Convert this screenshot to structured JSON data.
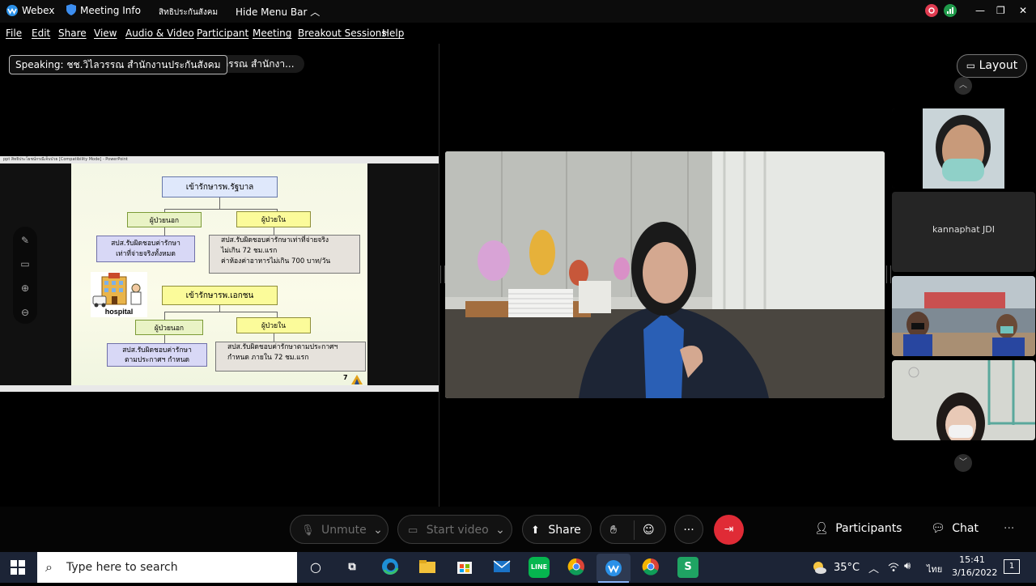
{
  "titlebar": {
    "app_name": "Webex",
    "meeting_info": "Meeting Info",
    "meeting_name": "สิทธิประกันสังคม",
    "hide_menu": "Hide Menu Bar",
    "minimize": "—",
    "restore": "❐",
    "close": "✕"
  },
  "menubar": {
    "items": [
      "File",
      "Edit",
      "Share",
      "View",
      "Audio & Video",
      "Participant",
      "Meeting",
      "Breakout Sessions",
      "Help"
    ]
  },
  "speaking": {
    "label": "Speaking: ชช.วิไลวรรณ สำนักงานประกันสังคม",
    "ghost": "ไลวรรณ สำนักงา..."
  },
  "slide": {
    "window_title": "ppt สิทธิประโยชน์กรณีเจ็บป่วย [Compatibility Mode] - PowerPoint",
    "gov_hospital": "เข้ารักษารพ.รัฐบาล",
    "opd1": "ผู้ป่วยนอก",
    "ipd1": "ผู้ป่วยใน",
    "opd1_desc": [
      "สปส.รับผิดชอบค่ารักษา",
      "เท่าที่จ่ายจริงทั้งหมด"
    ],
    "ipd1_desc": [
      "สปส.รับผิดชอบค่ารักษาเท่าที่จ่ายจริง",
      "ไม่เกิน 72 ชม.แรก",
      "ค่าห้องค่าอาหารไม่เกิน 700 บาท/วัน"
    ],
    "hospital_label": "hospital",
    "private_hospital": "เข้ารักษารพ.เอกชน",
    "opd2": "ผู้ป่วยนอก",
    "ipd2": "ผู้ป่วยใน",
    "opd2_desc": [
      "สปส.รับผิดชอบค่ารักษา",
      "ตามประกาศฯ กำหนด"
    ],
    "ipd2_desc": [
      "สปส.รับผิดชอบค่ารักษาตามประกาศฯ",
      "กำหนด ภายใน 72 ชม.แรก"
    ],
    "page_number": "7"
  },
  "layout_button": {
    "label": "Layout",
    "icon": "layout-icon"
  },
  "participants_thumbs": [
    {
      "name": ""
    },
    {
      "name": "kannaphat JDI"
    },
    {
      "name": ""
    },
    {
      "name": ""
    }
  ],
  "controls": {
    "unmute": "Unmute",
    "start_video": "Start video",
    "share": "Share",
    "participants": "Participants",
    "chat": "Chat",
    "more": "···",
    "ellipsis": "···"
  },
  "taskbar": {
    "search_placeholder": "Type here to search",
    "weather": "35°C",
    "language": "ไทย",
    "time": "15:41",
    "date": "3/16/2022",
    "notifications": "1"
  },
  "colors": {
    "end_call": "#e02b36",
    "taskbar": "#1c2436",
    "webex_logo": "#2b91e8"
  }
}
